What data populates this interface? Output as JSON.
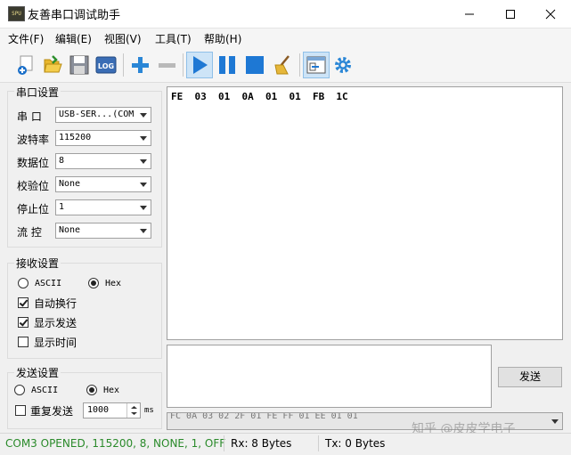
{
  "window": {
    "title": "友善串口调试助手",
    "app_icon_text": "SPU"
  },
  "menu": [
    "文件(F)",
    "编辑(E)",
    "视图(V)",
    "工具(T)",
    "帮助(H)"
  ],
  "toolbar": {
    "icons": [
      "new-icon",
      "open-icon",
      "save-icon",
      "log-icon",
      "add-icon",
      "remove-icon",
      "play-icon",
      "pause-icon",
      "stop-icon",
      "clear-icon",
      "window-icon",
      "settings-icon"
    ],
    "log_text": "LOG"
  },
  "serial": {
    "title": "串口设置",
    "port_label": "串  口",
    "port_value": "USB-SER...(COM",
    "baud_label": "波特率",
    "baud_value": "115200",
    "databits_label": "数据位",
    "databits_value": "8",
    "parity_label": "校验位",
    "parity_value": "None",
    "stopbits_label": "停止位",
    "stopbits_value": "1",
    "flow_label": "流  控",
    "flow_value": "None"
  },
  "receive": {
    "title": "接收设置",
    "ascii_label": "ASCII",
    "hex_label": "Hex",
    "mode_selected": "Hex",
    "wrap_label": "自动换行",
    "wrap_checked": true,
    "show_send_label": "显示发送",
    "show_send_checked": true,
    "show_time_label": "显示时间",
    "show_time_checked": false
  },
  "send": {
    "title": "发送设置",
    "ascii_label": "ASCII",
    "hex_label": "Hex",
    "mode_selected": "Hex",
    "repeat_label": "重复发送",
    "repeat_checked": false,
    "interval_value": "1000",
    "interval_unit": "ms",
    "send_button": "发送",
    "history_value": "FC 0A 03 02 2F 01 FE FF 01 EE 01 01"
  },
  "receive_text": "FE  03  01  0A  01  01  FB  1C",
  "status": {
    "port": "COM3 OPENED, 115200, 8, NONE, 1, OFF",
    "port_color": "#2a8a2a",
    "rx": "Rx: 8 Bytes",
    "tx": "Tx: 0 Bytes"
  },
  "watermark": "知乎 @皮皮学电子"
}
